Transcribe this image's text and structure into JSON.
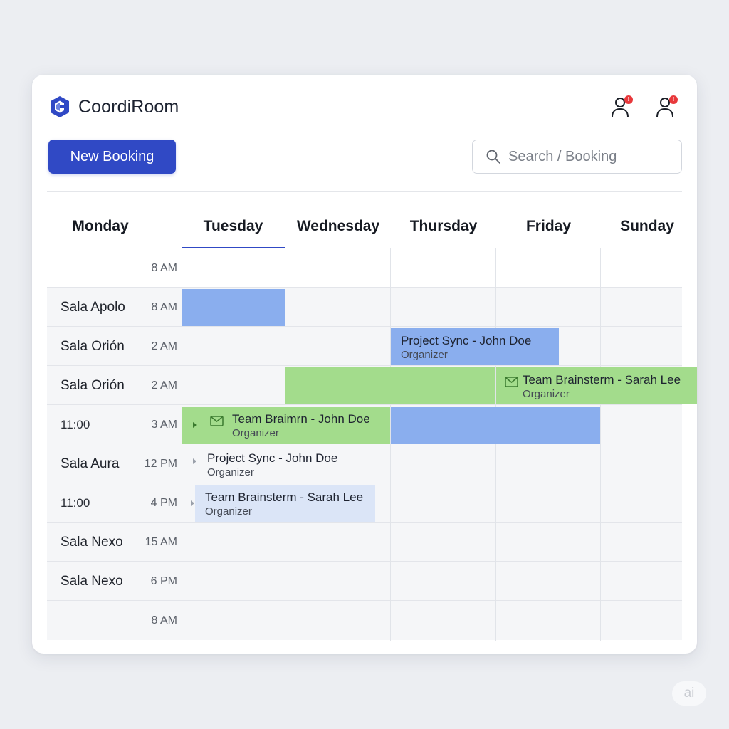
{
  "app": {
    "name": "CoordiRoom"
  },
  "header": {
    "new_booking_label": "New Booking",
    "search_placeholder": "Search / Booking",
    "notif_badge_1": "!",
    "notif_badge_2": "!"
  },
  "days": [
    "Monday",
    "Tuesday",
    "Wednesday",
    "Thursday",
    "Friday",
    "Sunday"
  ],
  "active_day": "Tuesday",
  "rows": [
    {
      "room": "",
      "time": "8 AM"
    },
    {
      "room": "Sala Apolo",
      "time": "8 AM"
    },
    {
      "room": "Sala Orión",
      "time": "2 AM"
    },
    {
      "room": "Sala Orión",
      "time": "2 AM"
    },
    {
      "room": "11:00",
      "time": "3 AM"
    },
    {
      "room": "Sala Aura",
      "time": "12 PM"
    },
    {
      "room": "11:00",
      "time": "4 PM"
    },
    {
      "room": "Sala Nexo",
      "time": "15 AM"
    },
    {
      "room": "Sala Nexo",
      "time": "6 PM"
    },
    {
      "room": "",
      "time": "8 AM"
    }
  ],
  "events": {
    "apolo_tuesday": {
      "title": "",
      "subtitle": ""
    },
    "project_sync_thursday": {
      "title": "Project Sync - John Doe",
      "subtitle": "Organizer"
    },
    "orion_wednesday": {
      "title": "",
      "subtitle": ""
    },
    "team_brainsterm_friday": {
      "title": "Team Brainsterm - Sarah Lee",
      "subtitle": "Organizer"
    },
    "team_braimrn_tuesday": {
      "title": "Team Braimrn - John Doe",
      "subtitle": "Organizer"
    },
    "thursday_3am_block": {
      "title": "",
      "subtitle": ""
    },
    "project_sync_tuesday": {
      "title": "Project Sync - John Doe",
      "subtitle": "Organizer"
    },
    "team_brainsterm_tuesday": {
      "title": "Team Brainsterm - Sarah Lee",
      "subtitle": "Organizer"
    }
  },
  "colors": {
    "accent": "#3049c5",
    "event_blue": "#8aaeee",
    "event_green": "#a3dc8c",
    "event_pale": "#dbe5f7",
    "badge": "#e8383b"
  },
  "watermark": "ai"
}
